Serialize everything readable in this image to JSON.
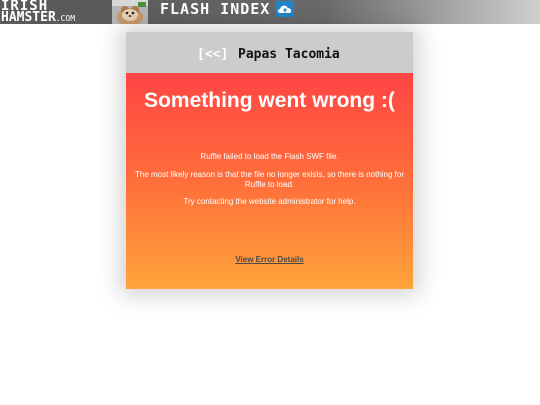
{
  "header": {
    "logo_line1": "IRISH",
    "logo_line2": "HAMSTER",
    "logo_suffix": ".COM",
    "nav_title": "FLASH INDEX",
    "cloud_icon": "cloud-upload-icon"
  },
  "card": {
    "back_label": "[<<]",
    "game_title": "Papas Tacomia",
    "error_heading": "Something went wrong :(",
    "line1": "Ruffle failed to load the Flash SWF file.",
    "line2": "The most likely reason is that the file no longer exists, so there is nothing for Ruffle to load.",
    "line3": "Try contacting the website administrator for help.",
    "details_link": "View Error Details"
  },
  "colors": {
    "error_top": "#ff4545",
    "error_bottom": "#ffa43a",
    "header_gray": "#cccccc",
    "cloud_blue": "#1f87c9"
  }
}
